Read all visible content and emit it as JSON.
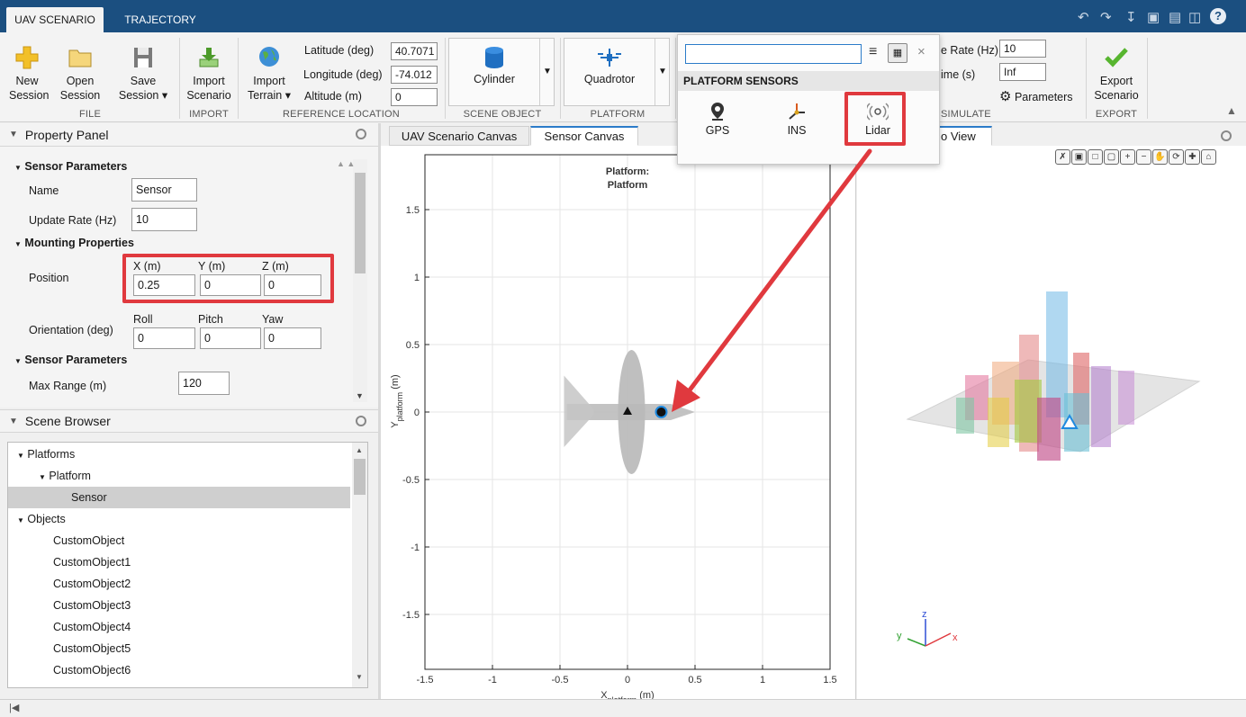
{
  "top_tabs": [
    "UAV SCENARIO",
    "TRAJECTORY"
  ],
  "ribbon": {
    "file": {
      "new": "New",
      "new2": "Session",
      "open": "Open",
      "open2": "Session",
      "save": "Save",
      "save2": "Session",
      "label": "FILE"
    },
    "import": {
      "import_scenario": "Import",
      "import_scenario2": "Scenario",
      "import_terrain": "Import",
      "import_terrain2": "Terrain",
      "label": "IMPORT"
    },
    "reference_location": {
      "label": "REFERENCE LOCATION",
      "latitude_label": "Latitude (deg)",
      "latitude_value": "40.7071",
      "longitude_label": "Longitude (deg)",
      "longitude_value": "-74.012",
      "altitude_label": "Altitude (m)",
      "altitude_value": "0"
    },
    "scene_object": {
      "label": "SCENE OBJECT",
      "value": "Cylinder"
    },
    "platform": {
      "label": "PLATFORM",
      "value": "Quadrotor"
    },
    "simulate": {
      "label": "SIMULATE",
      "rate_label": "e Rate (Hz)",
      "rate_value": "10",
      "time_label": "ime (s)",
      "time_value": "Inf",
      "parameters": "Parameters"
    },
    "export": {
      "label": "EXPORT",
      "btn": "Export",
      "btn2": "Scenario"
    }
  },
  "sensor_popup": {
    "search_value": "",
    "header": "PLATFORM SENSORS",
    "items": [
      "GPS",
      "INS",
      "Lidar"
    ]
  },
  "property_panel": {
    "title": "Property Panel",
    "sensor_params_header": "Sensor Parameters",
    "name_label": "Name",
    "name_value": "Sensor",
    "update_rate_label": "Update Rate (Hz)",
    "update_rate_value": "10",
    "mounting_header": "Mounting Properties",
    "position_label": "Position",
    "x_label": "X (m)",
    "y_label": "Y (m)",
    "z_label": "Z (m)",
    "x_value": "0.25",
    "y_value": "0",
    "z_value": "0",
    "orientation_label": "Orientation (deg)",
    "roll_label": "Roll",
    "pitch_label": "Pitch",
    "yaw_label": "Yaw",
    "roll_value": "0",
    "pitch_value": "0",
    "yaw_value": "0",
    "sensor_params_header2": "Sensor Parameters",
    "max_range_label": "Max Range (m)",
    "max_range_value": "120"
  },
  "scene_browser": {
    "title": "Scene Browser",
    "platforms": "Platforms",
    "platform": "Platform",
    "sensor": "Sensor",
    "objects": "Objects",
    "object_items": [
      "CustomObject",
      "CustomObject1",
      "CustomObject2",
      "CustomObject3",
      "CustomObject4",
      "CustomObject5",
      "CustomObject6"
    ]
  },
  "canvas_tabs": [
    "UAV Scenario Canvas",
    "Sensor Canvas",
    "o View"
  ],
  "chart_data": {
    "type": "scatter",
    "title": "Platform:\nPlatform",
    "title_lines": [
      "Platform:",
      "Platform"
    ],
    "xlabel": "X",
    "xlabel_sub": "platform",
    "xlabel_unit": " (m)",
    "ylabel": "Y",
    "ylabel_sub": "platform",
    "ylabel_unit": " (m)",
    "xlim": [
      -1.5,
      1.5
    ],
    "ylim": [
      -1.5,
      1.5
    ],
    "xticks": [
      -1.5,
      -1,
      -0.5,
      0,
      0.5,
      1,
      1.5
    ],
    "yticks": [
      -1.5,
      -1,
      -0.5,
      0,
      0.5,
      1,
      1.5
    ],
    "xtick_labels": [
      "-1.5",
      "-1",
      "-0.5",
      "0",
      "0.5",
      "1",
      "1.5"
    ],
    "ytick_labels": [
      "-1.5",
      "-1",
      "-0.5",
      "0",
      "0.5",
      "1",
      "1.5"
    ],
    "grid": true,
    "markers": [
      {
        "name": "platform-origin",
        "x": 0,
        "y": 0,
        "shape": "triangle"
      },
      {
        "name": "sensor",
        "x": 0.25,
        "y": 0,
        "shape": "circle"
      }
    ]
  },
  "axes_labels_3d": {
    "x": "x",
    "y": "y",
    "z": "z"
  },
  "colors": {
    "accent": "#e0393e",
    "topbar": "#1b4f80",
    "tab_active": "#2b7bc9"
  }
}
